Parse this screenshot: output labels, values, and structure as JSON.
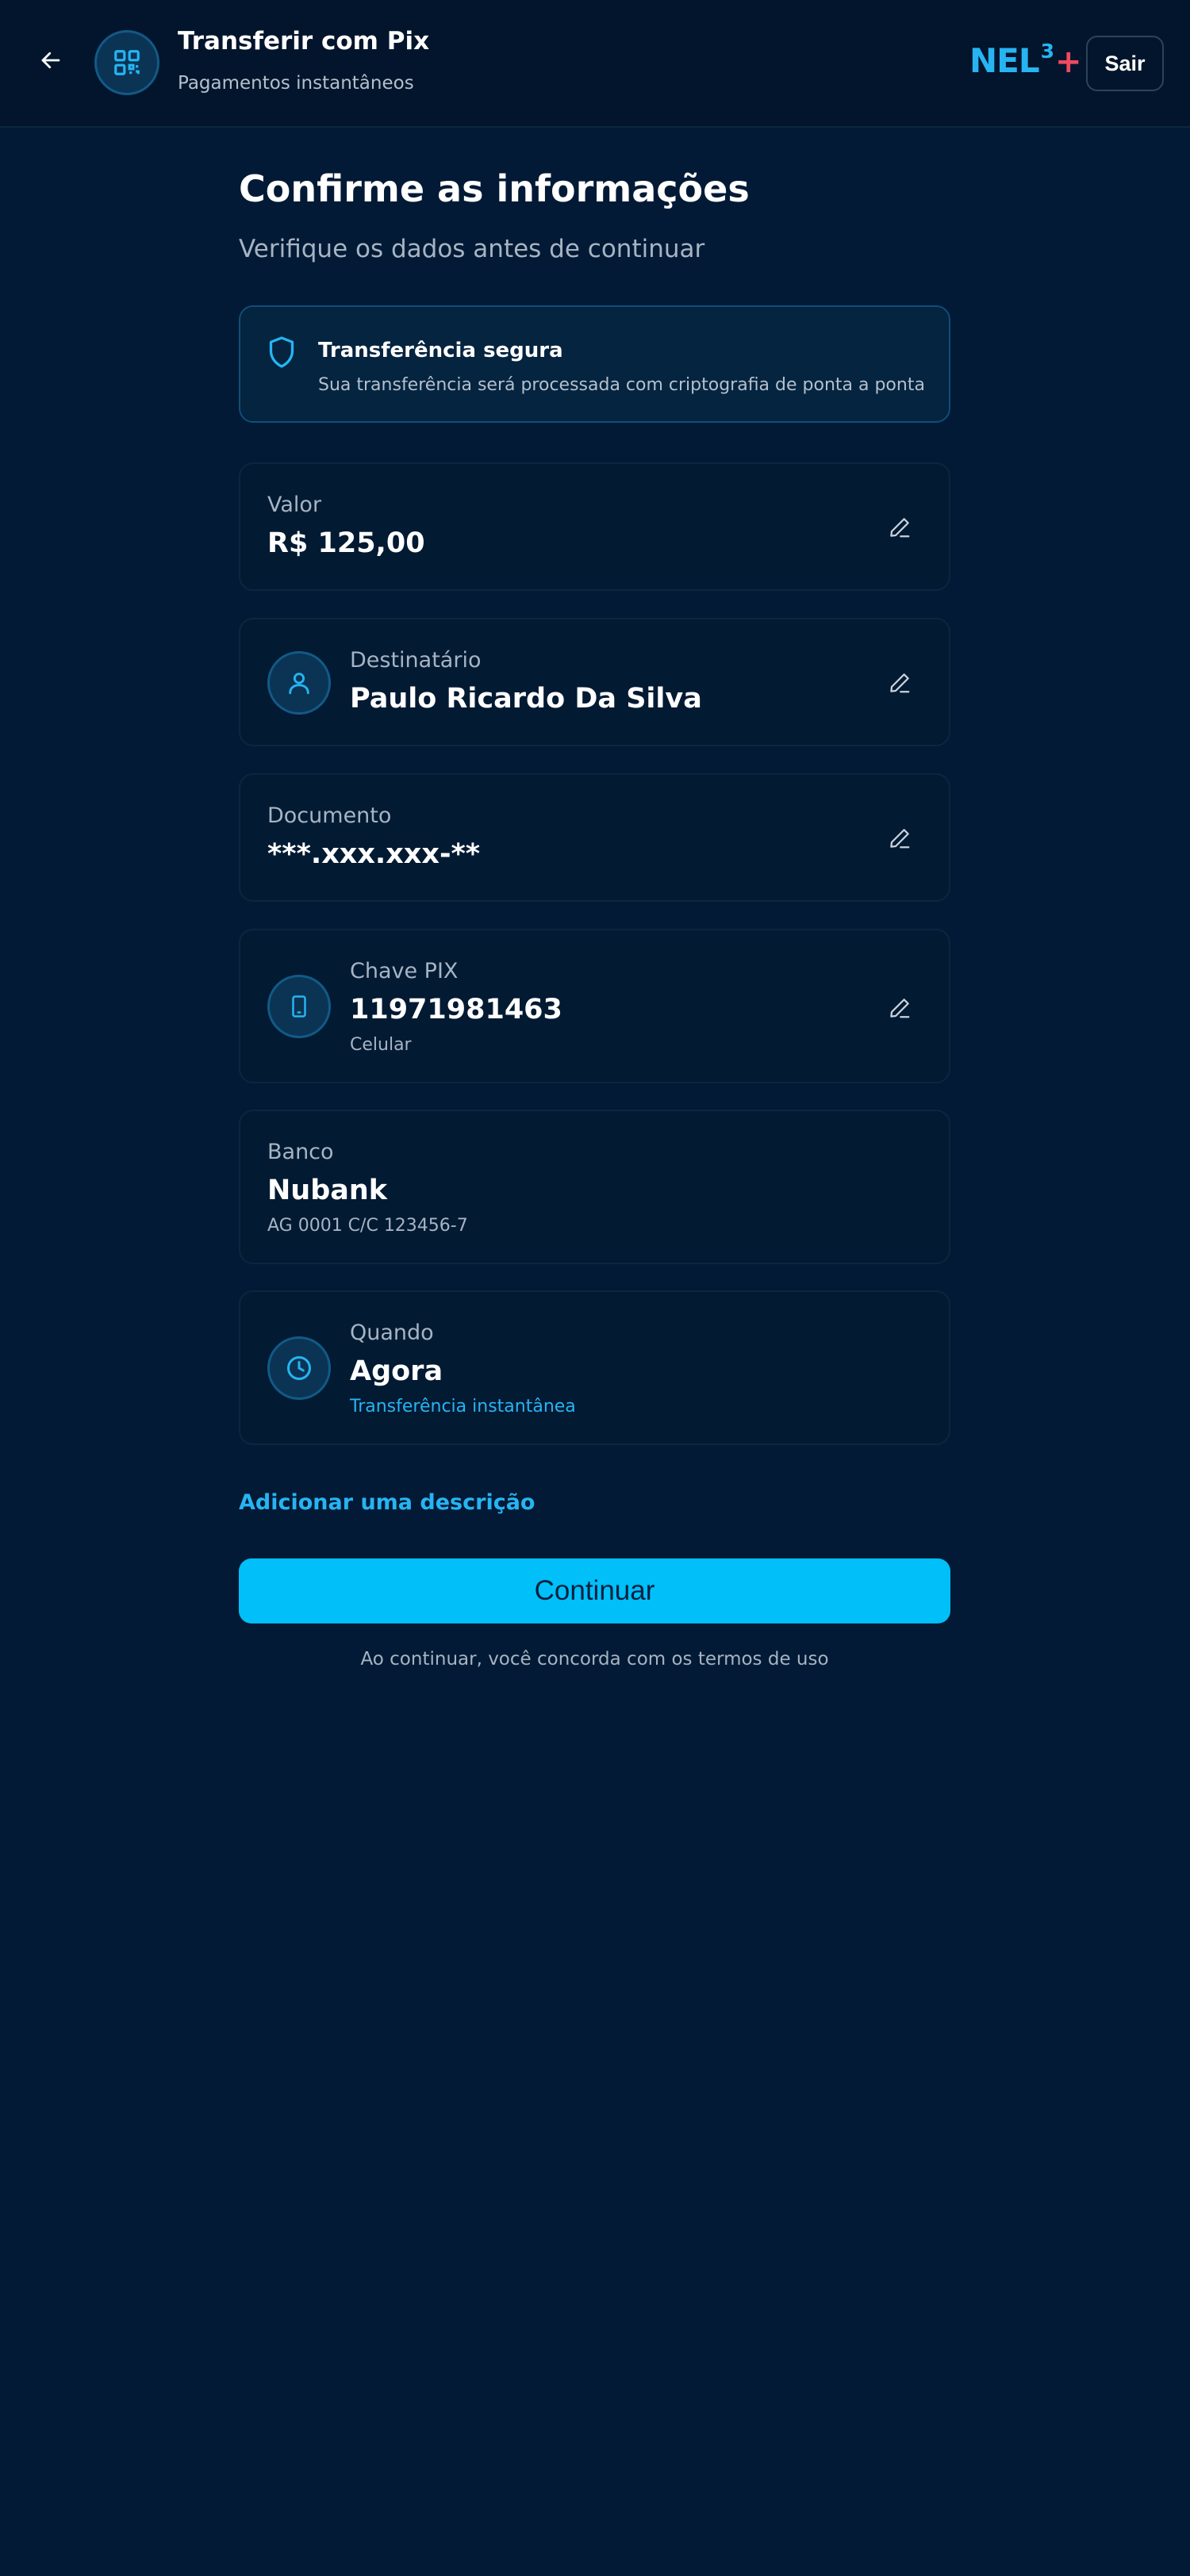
{
  "header": {
    "title": "Transferir com Pix",
    "subtitle": "Pagamentos instantâneos",
    "back_icon": "arrow-left-icon",
    "app_icon": "qr-code-icon",
    "brand": {
      "text": "NEL",
      "superscript": "3",
      "plus": "+"
    },
    "logout_label": "Sair"
  },
  "page": {
    "title": "Confirme as informações",
    "subtitle": "Verifique os dados antes de continuar"
  },
  "banner": {
    "icon": "shield-icon",
    "title": "Transferência segura",
    "text": "Sua transferência será processada com criptografia de ponta a ponta"
  },
  "details": {
    "valor": {
      "label": "Valor",
      "value": "R$ 125,00",
      "edit_icon": "pencil-icon"
    },
    "destinatario": {
      "label": "Destinatário",
      "value": "Paulo Ricardo Da Silva",
      "icon": "user-icon",
      "edit_icon": "pencil-icon"
    },
    "documento": {
      "label": "Documento",
      "value": "***.xxx.xxx-**",
      "edit_icon": "pencil-icon"
    },
    "chave": {
      "label": "Chave PIX",
      "value": "11971981463",
      "sub": "Celular",
      "icon": "smartphone-icon",
      "edit_icon": "pencil-icon"
    },
    "banco": {
      "label": "Banco",
      "value": "Nubank",
      "sub": "AG 0001 C/C 123456-7"
    },
    "quando": {
      "label": "Quando",
      "value": "Agora",
      "sub": "Transferência instantânea",
      "icon": "clock-icon"
    }
  },
  "actions": {
    "add_description": "Adicionar uma descrição",
    "continue_label": "Continuar",
    "terms": "Ao continuar, você concorda com os termos de uso"
  },
  "colors": {
    "background": "#021a35",
    "header": "#03152c",
    "accent": "#27b4f2",
    "button": "#00bff9",
    "brand_plus": "#f04a60"
  }
}
